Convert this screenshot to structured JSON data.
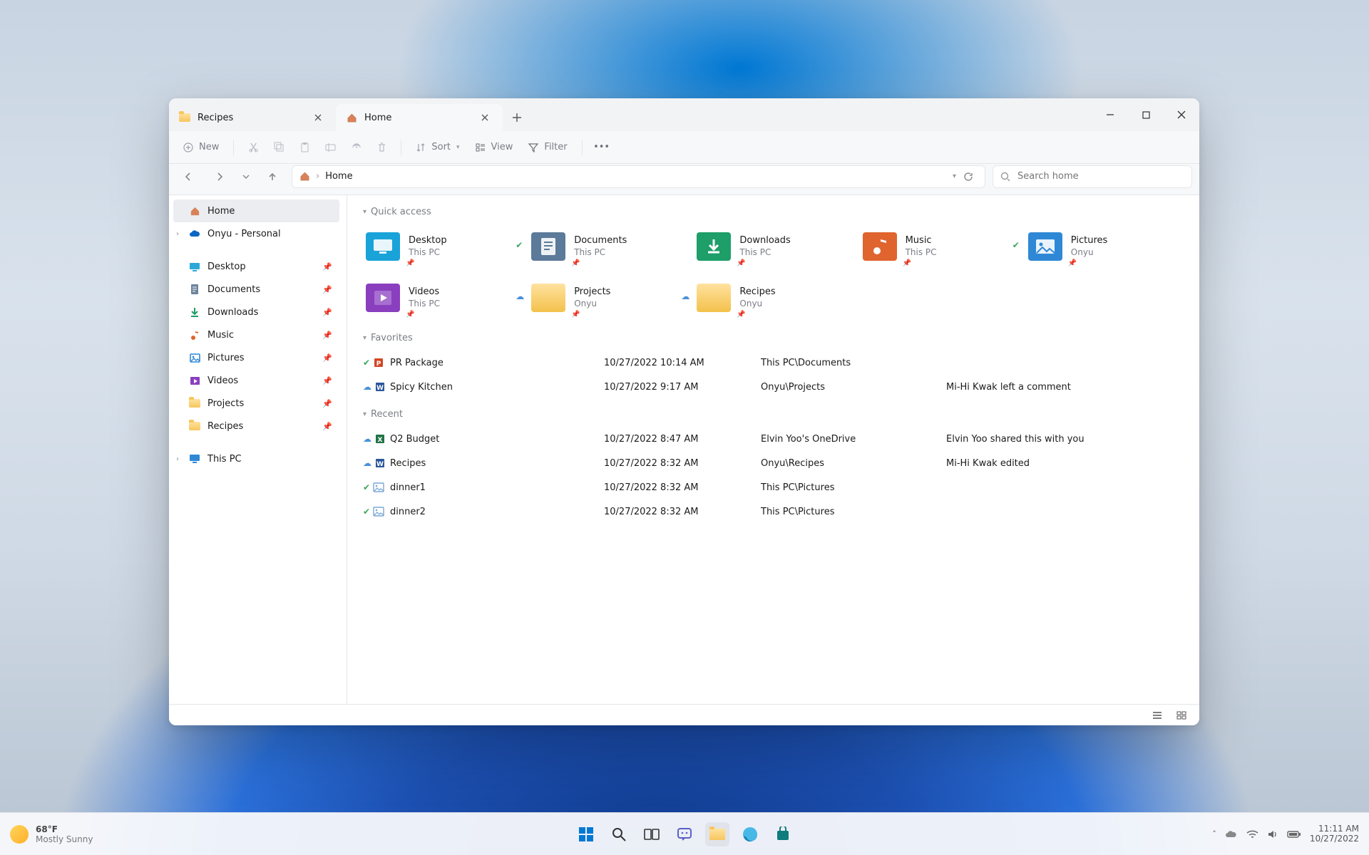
{
  "tabs": [
    {
      "label": "Recipes",
      "icon": "folder"
    },
    {
      "label": "Home",
      "icon": "home"
    }
  ],
  "active_tab_index": 1,
  "window_controls": {
    "min": "—",
    "max": "▢",
    "close": "✕"
  },
  "toolbar": {
    "new": "New",
    "sort": "Sort",
    "view": "View",
    "filter": "Filter"
  },
  "breadcrumb": {
    "root": "Home"
  },
  "search": {
    "placeholder": "Search home"
  },
  "sidebar": {
    "top": [
      {
        "label": "Home",
        "icon": "home"
      },
      {
        "label": "Onyu - Personal",
        "icon": "cloud",
        "expandable": true
      }
    ],
    "pinned": [
      {
        "label": "Desktop",
        "icon": "desktop"
      },
      {
        "label": "Documents",
        "icon": "documents"
      },
      {
        "label": "Downloads",
        "icon": "downloads"
      },
      {
        "label": "Music",
        "icon": "music"
      },
      {
        "label": "Pictures",
        "icon": "pictures"
      },
      {
        "label": "Videos",
        "icon": "videos"
      },
      {
        "label": "Projects",
        "icon": "folder"
      },
      {
        "label": "Recipes",
        "icon": "folder"
      }
    ],
    "bottom": [
      {
        "label": "This PC",
        "icon": "pc",
        "expandable": true
      }
    ]
  },
  "sections": {
    "quick": "Quick access",
    "favorites": "Favorites",
    "recent": "Recent"
  },
  "quick_access": [
    {
      "label": "Desktop",
      "sub": "This PC",
      "color": "#1aa3d9",
      "icon": "desktop",
      "pin": true
    },
    {
      "label": "Documents",
      "sub": "This PC",
      "color": "#5c7a99",
      "icon": "documents",
      "pin": true,
      "sync": true
    },
    {
      "label": "Downloads",
      "sub": "This PC",
      "color": "#1e9e68",
      "icon": "downloads",
      "pin": true
    },
    {
      "label": "Music",
      "sub": "This PC",
      "color": "#e0642e",
      "icon": "music",
      "pin": true
    },
    {
      "label": "Pictures",
      "sub": "Onyu",
      "color": "#2f88d6",
      "icon": "pictures",
      "pin": true,
      "sync": true
    },
    {
      "label": "Videos",
      "sub": "This PC",
      "color": "#8a3fbf",
      "icon": "videos",
      "pin": true
    },
    {
      "label": "Projects",
      "sub": "Onyu",
      "color": "#f3c14b",
      "icon": "folder",
      "pin": true,
      "cloud": true
    },
    {
      "label": "Recipes",
      "sub": "Onyu",
      "color": "#f3c14b",
      "icon": "folder",
      "pin": true,
      "cloud": true
    }
  ],
  "favorites": [
    {
      "name": "PR Package",
      "date": "10/27/2022 10:14 AM",
      "loc": "This PC\\Documents",
      "note": "",
      "ft": "ppt",
      "status": "sync"
    },
    {
      "name": "Spicy Kitchen",
      "date": "10/27/2022 9:17 AM",
      "loc": "Onyu\\Projects",
      "note": "Mi-Hi Kwak left a comment",
      "ft": "word",
      "status": "cloud"
    }
  ],
  "recent": [
    {
      "name": "Q2 Budget",
      "date": "10/27/2022 8:47 AM",
      "loc": "Elvin Yoo's OneDrive",
      "note": "Elvin Yoo shared this with you",
      "ft": "excel",
      "status": "cloud"
    },
    {
      "name": "Recipes",
      "date": "10/27/2022 8:32 AM",
      "loc": "Onyu\\Recipes",
      "note": "Mi-Hi Kwak edited",
      "ft": "word",
      "status": "cloud"
    },
    {
      "name": "dinner1",
      "date": "10/27/2022 8:32 AM",
      "loc": "This PC\\Pictures",
      "note": "",
      "ft": "image",
      "status": "sync"
    },
    {
      "name": "dinner2",
      "date": "10/27/2022 8:32 AM",
      "loc": "This PC\\Pictures",
      "note": "",
      "ft": "image",
      "status": "sync"
    }
  ],
  "taskbar": {
    "weather": {
      "temp": "68°F",
      "desc": "Mostly Sunny"
    },
    "time": "11:11 AM",
    "date": "10/27/2022"
  }
}
